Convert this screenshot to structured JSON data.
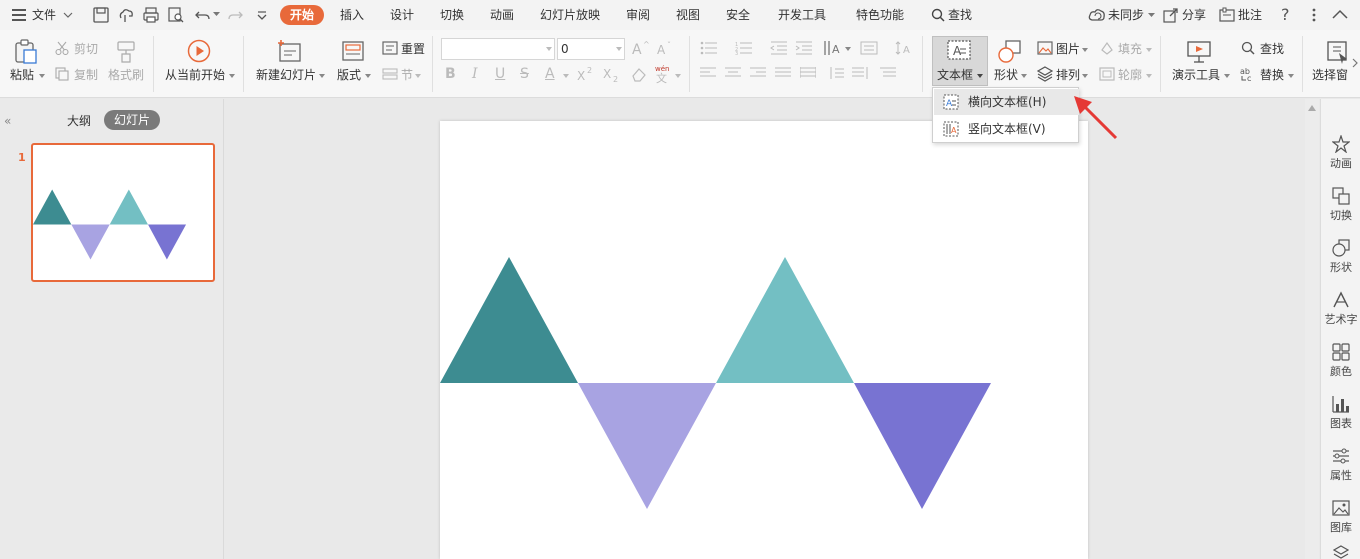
{
  "menubar": {
    "file_label": "文件",
    "tabs": [
      "开始",
      "插入",
      "设计",
      "切换",
      "动画",
      "幻灯片放映",
      "审阅",
      "视图",
      "安全",
      "开发工具",
      "特色功能"
    ],
    "search_label": "查找",
    "sync_label": "未同步",
    "share_label": "分享",
    "comment_label": "批注"
  },
  "ribbon": {
    "paste_label": "粘贴",
    "cut_label": "剪切",
    "copy_label": "复制",
    "format_painter_label": "格式刷",
    "from_current_label": "从当前开始",
    "new_slide_label": "新建幻灯片",
    "layout_label": "版式",
    "reset_label": "重置",
    "section_label": "节",
    "font_name_value": "",
    "font_size_value": "0",
    "textbox_label": "文本框",
    "shape_label": "形状",
    "picture_label": "图片",
    "arrange_label": "排列",
    "fill_label": "填充",
    "outline_label": "轮廓",
    "present_tools_label": "演示工具",
    "find_label": "查找",
    "replace_label": "替换",
    "select_pane_label": "选择窗"
  },
  "left_panel": {
    "tabs": [
      "大纲",
      "幻灯片"
    ],
    "slide_number": "1"
  },
  "dropdown": {
    "items": [
      "横向文本框(H)",
      "竖向文本框(V)"
    ]
  },
  "right_sidebar": {
    "items": [
      "动画",
      "切换",
      "形状",
      "艺术字",
      "颜色",
      "图表",
      "属性",
      "图库"
    ]
  },
  "colors": {
    "accent": "#e8693a",
    "triangle_teal": "#3d8c91",
    "triangle_light_teal": "#73bfc3",
    "triangle_lavender": "#a8a3e2",
    "triangle_purple": "#7873d2",
    "arrow_red": "#e53935"
  }
}
